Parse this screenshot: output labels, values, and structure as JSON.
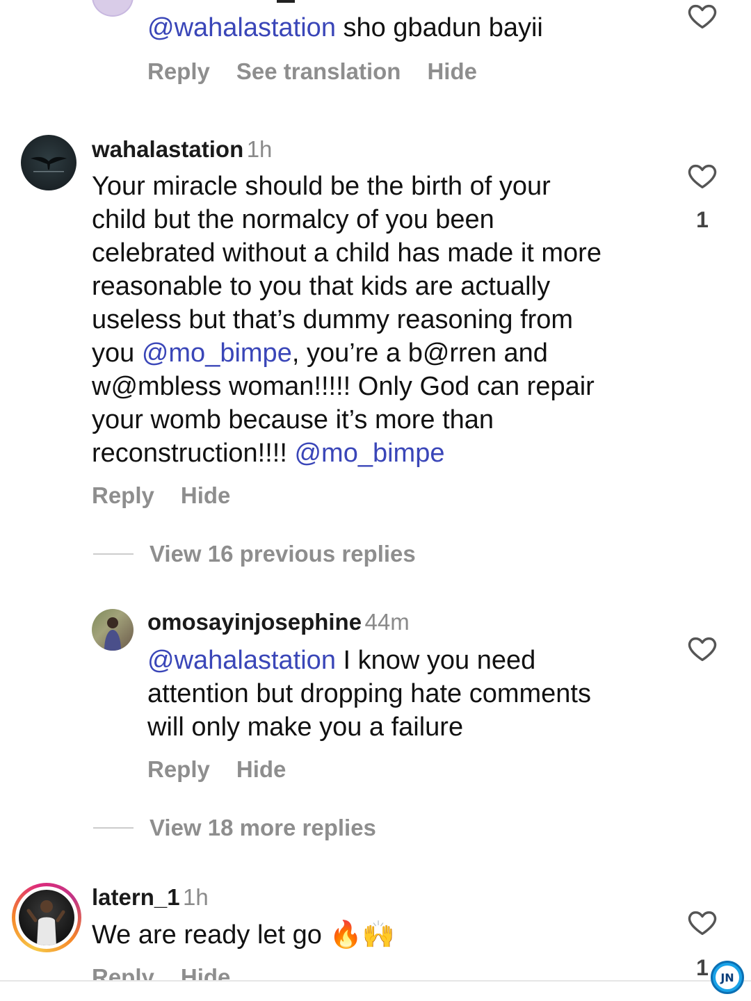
{
  "top_reply": {
    "mention": "@wahalastation",
    "text": " sho gbadun bayii",
    "actions": {
      "reply": "Reply",
      "translate": "See translation",
      "hide": "Hide"
    }
  },
  "comment_main": {
    "username": "wahalastation",
    "time": "1h",
    "lines": [
      "Your miracle should be the birth of your",
      "child but the normalcy of you been",
      "celebrated without a child has made it more",
      "reasonable to you that kids are actually",
      "useless but that’s dummy reasoning from"
    ],
    "line6_prefix": "you ",
    "line6_mention": "@mo_bimpe",
    "line6_suffix": ", you’re a b@rren and",
    "line7": "w@mbless woman!!!!! Only God can repair",
    "line8": "your womb because it’s more than",
    "line9_prefix": "reconstruction!!!! ",
    "line9_mention": "@mo_bimpe",
    "like_count": "1",
    "actions": {
      "reply": "Reply",
      "hide": "Hide"
    },
    "view_previous": "View 16 previous replies"
  },
  "reply_omosa": {
    "username": "omosayinjosephine",
    "time": "44m",
    "mention": "@wahalastation",
    "line1_suffix": " I know you need",
    "line2": "attention but dropping hate comments",
    "line3": "will only make you a failure",
    "actions": {
      "reply": "Reply",
      "hide": "Hide"
    },
    "view_more": "View 18 more replies"
  },
  "comment_latern": {
    "username": "latern_1",
    "time": "1h",
    "text": "We are ready let go ",
    "emojis": "🔥🙌",
    "like_count": "1",
    "actions": {
      "reply": "Reply",
      "hide": "Hide"
    }
  },
  "watermark": {
    "text": "JN"
  },
  "colors": {
    "mention": "#3a46b8",
    "meta": "#8e8e8e",
    "story_ring": "#f5a623"
  }
}
